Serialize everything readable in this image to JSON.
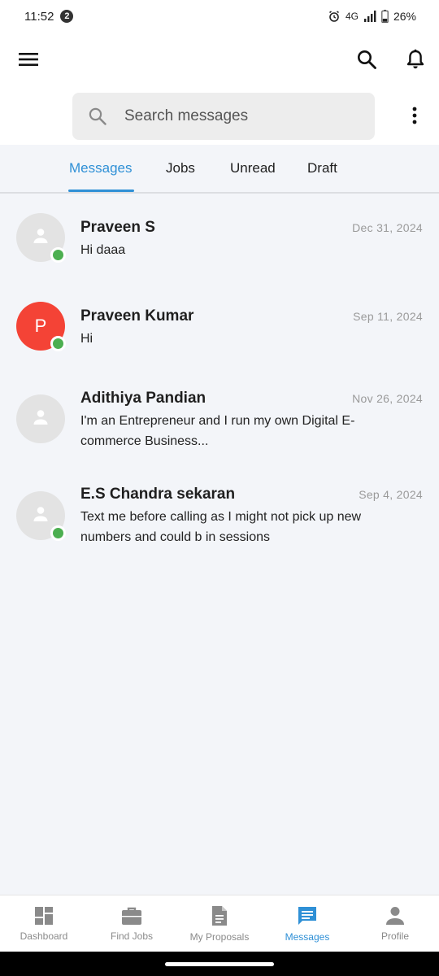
{
  "status_bar": {
    "time": "11:52",
    "notification_count": "2",
    "network": "4G",
    "battery": "26%"
  },
  "search": {
    "placeholder": "Search messages"
  },
  "tabs": [
    {
      "label": "Messages",
      "active": true
    },
    {
      "label": "Jobs",
      "active": false
    },
    {
      "label": "Unread",
      "active": false
    },
    {
      "label": "Draft",
      "active": false
    }
  ],
  "conversations": [
    {
      "name": "Praveen S",
      "date": "Dec 31, 2024",
      "preview": "Hi daaa",
      "avatar": "person-icon",
      "online": true
    },
    {
      "name": "Praveen Kumar",
      "date": "Sep 11, 2024",
      "preview": "Hi",
      "avatar_letter": "P",
      "avatar_color": "#f44336",
      "online": true
    },
    {
      "name": "Adithiya Pandian",
      "date": "Nov 26, 2024",
      "preview": "I'm an Entrepreneur and I run my own Digital E-commerce Business...",
      "avatar": "person-icon",
      "online": false
    },
    {
      "name": "E.S Chandra sekaran",
      "date": "Sep 4, 2024",
      "preview": "Text me before calling as I might not pick up new numbers and could b in sessions",
      "avatar": "person-icon",
      "online": true
    }
  ],
  "bottom_nav": [
    {
      "label": "Dashboard",
      "icon": "dashboard-icon",
      "active": false
    },
    {
      "label": "Find Jobs",
      "icon": "briefcase-icon",
      "active": false
    },
    {
      "label": "My Proposals",
      "icon": "document-icon",
      "active": false
    },
    {
      "label": "Messages",
      "icon": "chat-icon",
      "active": true
    },
    {
      "label": "Profile",
      "icon": "profile-icon",
      "active": false
    }
  ],
  "colors": {
    "accent": "#2f90d6",
    "online": "#4caf50",
    "avatar_red": "#f44336",
    "background": "#f3f5f9"
  }
}
